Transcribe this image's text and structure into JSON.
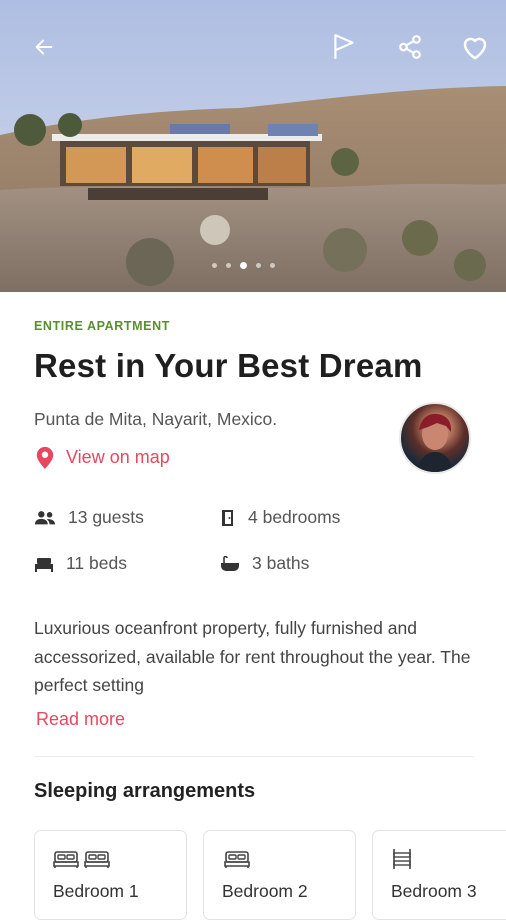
{
  "header": {
    "back_icon": "arrow-left-icon",
    "actions": [
      "flag-icon",
      "share-icon",
      "heart-icon"
    ]
  },
  "carousel": {
    "count": 5,
    "active": 2
  },
  "listing": {
    "type_label": "ENTIRE APARTMENT",
    "title": "Rest in Your Best Dream",
    "location": "Punta de Mita, Nayarit, Mexico.",
    "map_link": "View on map",
    "features": {
      "guests": "13 guests",
      "bedrooms": "4 bedrooms",
      "beds": "11 beds",
      "baths": "3 baths"
    },
    "description": "Luxurious oceanfront property, fully furnished and accessorized, available for rent throughout the year. The perfect setting",
    "read_more": "Read more"
  },
  "sleeping": {
    "title": "Sleeping arrangements",
    "rooms": [
      {
        "label": "Bedroom 1",
        "icon": "double-bed-icon"
      },
      {
        "label": "Bedroom 2",
        "icon": "double-bed-icon"
      },
      {
        "label": "Bedroom 3",
        "icon": "bunk-bed-icon"
      }
    ]
  },
  "colors": {
    "accent": "#e8475f",
    "type_label": "#5a8f2e"
  }
}
